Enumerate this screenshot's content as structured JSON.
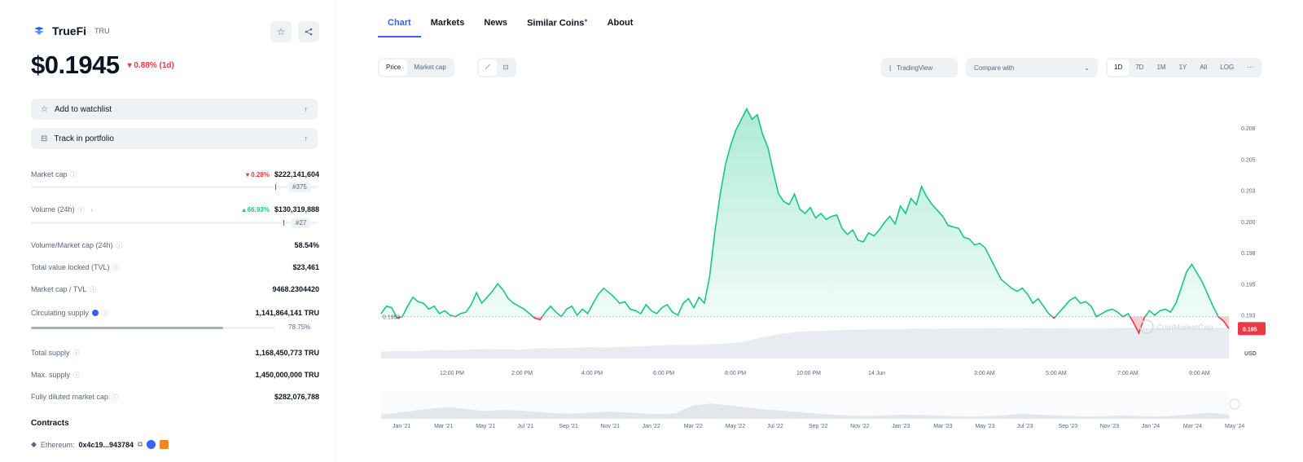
{
  "coin": {
    "name": "TrueFi",
    "symbol": "TRU",
    "price": "$0.1945",
    "change": "▾ 0.88% (1d)"
  },
  "header_actions": {
    "star_icon": "☆",
    "share_icon": "⋖"
  },
  "buttons": {
    "watchlist": "Add to watchlist",
    "portfolio": "Track in portfolio"
  },
  "stats": {
    "market_cap": {
      "label": "Market cap",
      "change": "▾ 0.28%",
      "value": "$222,141,604",
      "rank": "#375"
    },
    "volume": {
      "label": "Volume (24h)",
      "change": "▴ 66.93%",
      "value": "$130,319,888",
      "rank": "#27"
    },
    "vol_mcap": {
      "label": "Volume/Market cap (24h)",
      "value": "58.54%"
    },
    "tvl": {
      "label": "Total value locked (TVL)",
      "value": "$23,461"
    },
    "mcap_tvl": {
      "label": "Market cap / TVL",
      "value": "9468.2304420"
    },
    "circ_supply": {
      "label": "Circulating supply",
      "value": "1,141,864,141 TRU",
      "percent": "78.75%",
      "fill": 0.7875
    },
    "total_supply": {
      "label": "Total supply",
      "value": "1,168,450,773 TRU"
    },
    "max_supply": {
      "label": "Max. supply",
      "value": "1,450,000,000 TRU"
    },
    "fdv": {
      "label": "Fully diluted market cap",
      "value": "$282,076,788"
    }
  },
  "contracts": {
    "title": "Contracts",
    "network": "Ethereum:",
    "address": "0x4c19...943784"
  },
  "tabs": [
    "Chart",
    "Markets",
    "News",
    "Similar Coins",
    "About"
  ],
  "toolbar": {
    "type_toggle": [
      "Price",
      "Market cap"
    ],
    "style_toggle": [
      "⟋",
      "⊡"
    ],
    "tradingview": "TradingView",
    "compare": "Compare with",
    "ranges": [
      "1D",
      "7D",
      "1M",
      "1Y",
      "All",
      "LOG",
      "⋯"
    ]
  },
  "chart_data": {
    "type": "area",
    "x_time_labels": [
      "12:00 PM",
      "2:00 PM",
      "4:00 PM",
      "6:00 PM",
      "8:00 PM",
      "10:00 PM",
      "14 Jun",
      "3:00 AM",
      "5:00 AM",
      "7:00 AM",
      "9:00 AM"
    ],
    "y_labels": [
      "0.208",
      "0.205",
      "0.203",
      "0.200",
      "0.198",
      "0.195",
      "0.193"
    ],
    "ylim": [
      0.1925,
      0.2095
    ],
    "open_value": 0.1953,
    "open_label": "0.1953",
    "current_value": 0.1945,
    "current_label": "0.195",
    "currency": "USD",
    "watermark": "CoinMarketCap",
    "nav_labels": [
      "Jan '21",
      "Mar '21",
      "May '21",
      "Jul '21",
      "Sep '21",
      "Nov '21",
      "Jan '22",
      "Mar '22",
      "May '22",
      "Jul '22",
      "Sep '22",
      "Nov '22",
      "Jan '23",
      "Mar '23",
      "May '23",
      "Jul '23",
      "Sep '23",
      "Nov '23",
      "Jan '24",
      "Mar '24",
      "May '24"
    ],
    "colors": {
      "up": "#16c784",
      "down": "#ea3943",
      "volume": "#e8ebef"
    },
    "series": [
      {
        "values": [
          0.1955,
          0.196,
          0.1959,
          0.1952,
          0.1953,
          0.196,
          0.1966,
          0.1963,
          0.1962,
          0.1958,
          0.196,
          0.1955,
          0.1957,
          0.1954,
          0.1953,
          0.1955,
          0.1956,
          0.1961,
          0.1969,
          0.1962,
          0.1966,
          0.197,
          0.1975,
          0.1971,
          0.1965,
          0.1962,
          0.196,
          0.1958,
          0.1955,
          0.1952,
          0.1951,
          0.1956,
          0.196,
          0.1956,
          0.1953,
          0.1958,
          0.196,
          0.1954,
          0.1958,
          0.1955,
          0.1962,
          0.1968,
          0.1972,
          0.1969,
          0.1966,
          0.1962,
          0.1963,
          0.1958,
          0.1957,
          0.1955,
          0.1961,
          0.1957,
          0.1955,
          0.1959,
          0.1961,
          0.1956,
          0.1954,
          0.1962,
          0.1965,
          0.1959,
          0.1966,
          0.1962,
          0.198,
          0.201,
          0.2035,
          0.2055,
          0.2068,
          0.2078,
          0.2085,
          0.2092,
          0.2085,
          0.2088,
          0.2075,
          0.2066,
          0.205,
          0.2035,
          0.203,
          0.2028,
          0.2035,
          0.2025,
          0.2022,
          0.2026,
          0.2019,
          0.2022,
          0.2018,
          0.202,
          0.2021,
          0.2012,
          0.2008,
          0.2011,
          0.2004,
          0.2003,
          0.2009,
          0.2007,
          0.2011,
          0.2016,
          0.202,
          0.2015,
          0.2027,
          0.2022,
          0.2032,
          0.2028,
          0.204,
          0.2033,
          0.2028,
          0.2024,
          0.202,
          0.2014,
          0.2013,
          0.2012,
          0.2006,
          0.2005,
          0.2001,
          0.2002,
          0.1999,
          0.1992,
          0.1985,
          0.1978,
          0.1975,
          0.1972,
          0.197,
          0.1972,
          0.1968,
          0.1962,
          0.1965,
          0.196,
          0.1955,
          0.1952,
          0.1956,
          0.196,
          0.1964,
          0.1966,
          0.1962,
          0.1963,
          0.196,
          0.1953,
          0.1955,
          0.1957,
          0.1958,
          0.1956,
          0.1953,
          0.1955,
          0.1949,
          0.1942,
          0.1952,
          0.1957,
          0.1954,
          0.1957,
          0.1958,
          0.1956,
          0.1962,
          0.1972,
          0.1983,
          0.1988,
          0.1982,
          0.1976,
          0.1968,
          0.196,
          0.1953,
          0.195,
          0.1945
        ]
      }
    ],
    "volume": [
      0.2,
      0.22,
      0.21,
      0.25,
      0.24,
      0.26,
      0.28,
      0.27,
      0.26,
      0.29,
      0.3,
      0.31,
      0.33,
      0.32,
      0.34,
      0.36,
      0.38,
      0.4,
      0.39,
      0.42,
      0.44,
      0.5,
      0.62,
      0.71,
      0.78,
      0.8,
      0.82,
      0.84,
      0.85,
      0.86,
      0.86,
      0.87,
      0.87,
      0.88,
      0.88,
      0.88,
      0.89,
      0.89,
      0.88,
      0.88,
      0.89,
      0.89,
      0.89,
      0.9,
      0.9,
      0.89,
      0.9,
      0.9,
      0.9,
      0.9
    ],
    "nav_area": [
      0.15,
      0.22,
      0.3,
      0.38,
      0.42,
      0.35,
      0.28,
      0.32,
      0.3,
      0.25,
      0.2,
      0.18,
      0.22,
      0.26,
      0.24,
      0.2,
      0.17,
      0.2,
      0.48,
      0.55,
      0.5,
      0.42,
      0.35,
      0.3,
      0.25,
      0.2,
      0.15,
      0.12,
      0.1,
      0.12,
      0.15,
      0.14,
      0.12,
      0.1,
      0.08,
      0.1,
      0.12,
      0.18,
      0.15,
      0.12,
      0.1,
      0.08,
      0.1,
      0.12,
      0.1,
      0.08,
      0.12,
      0.18,
      0.22,
      0.15
    ]
  }
}
